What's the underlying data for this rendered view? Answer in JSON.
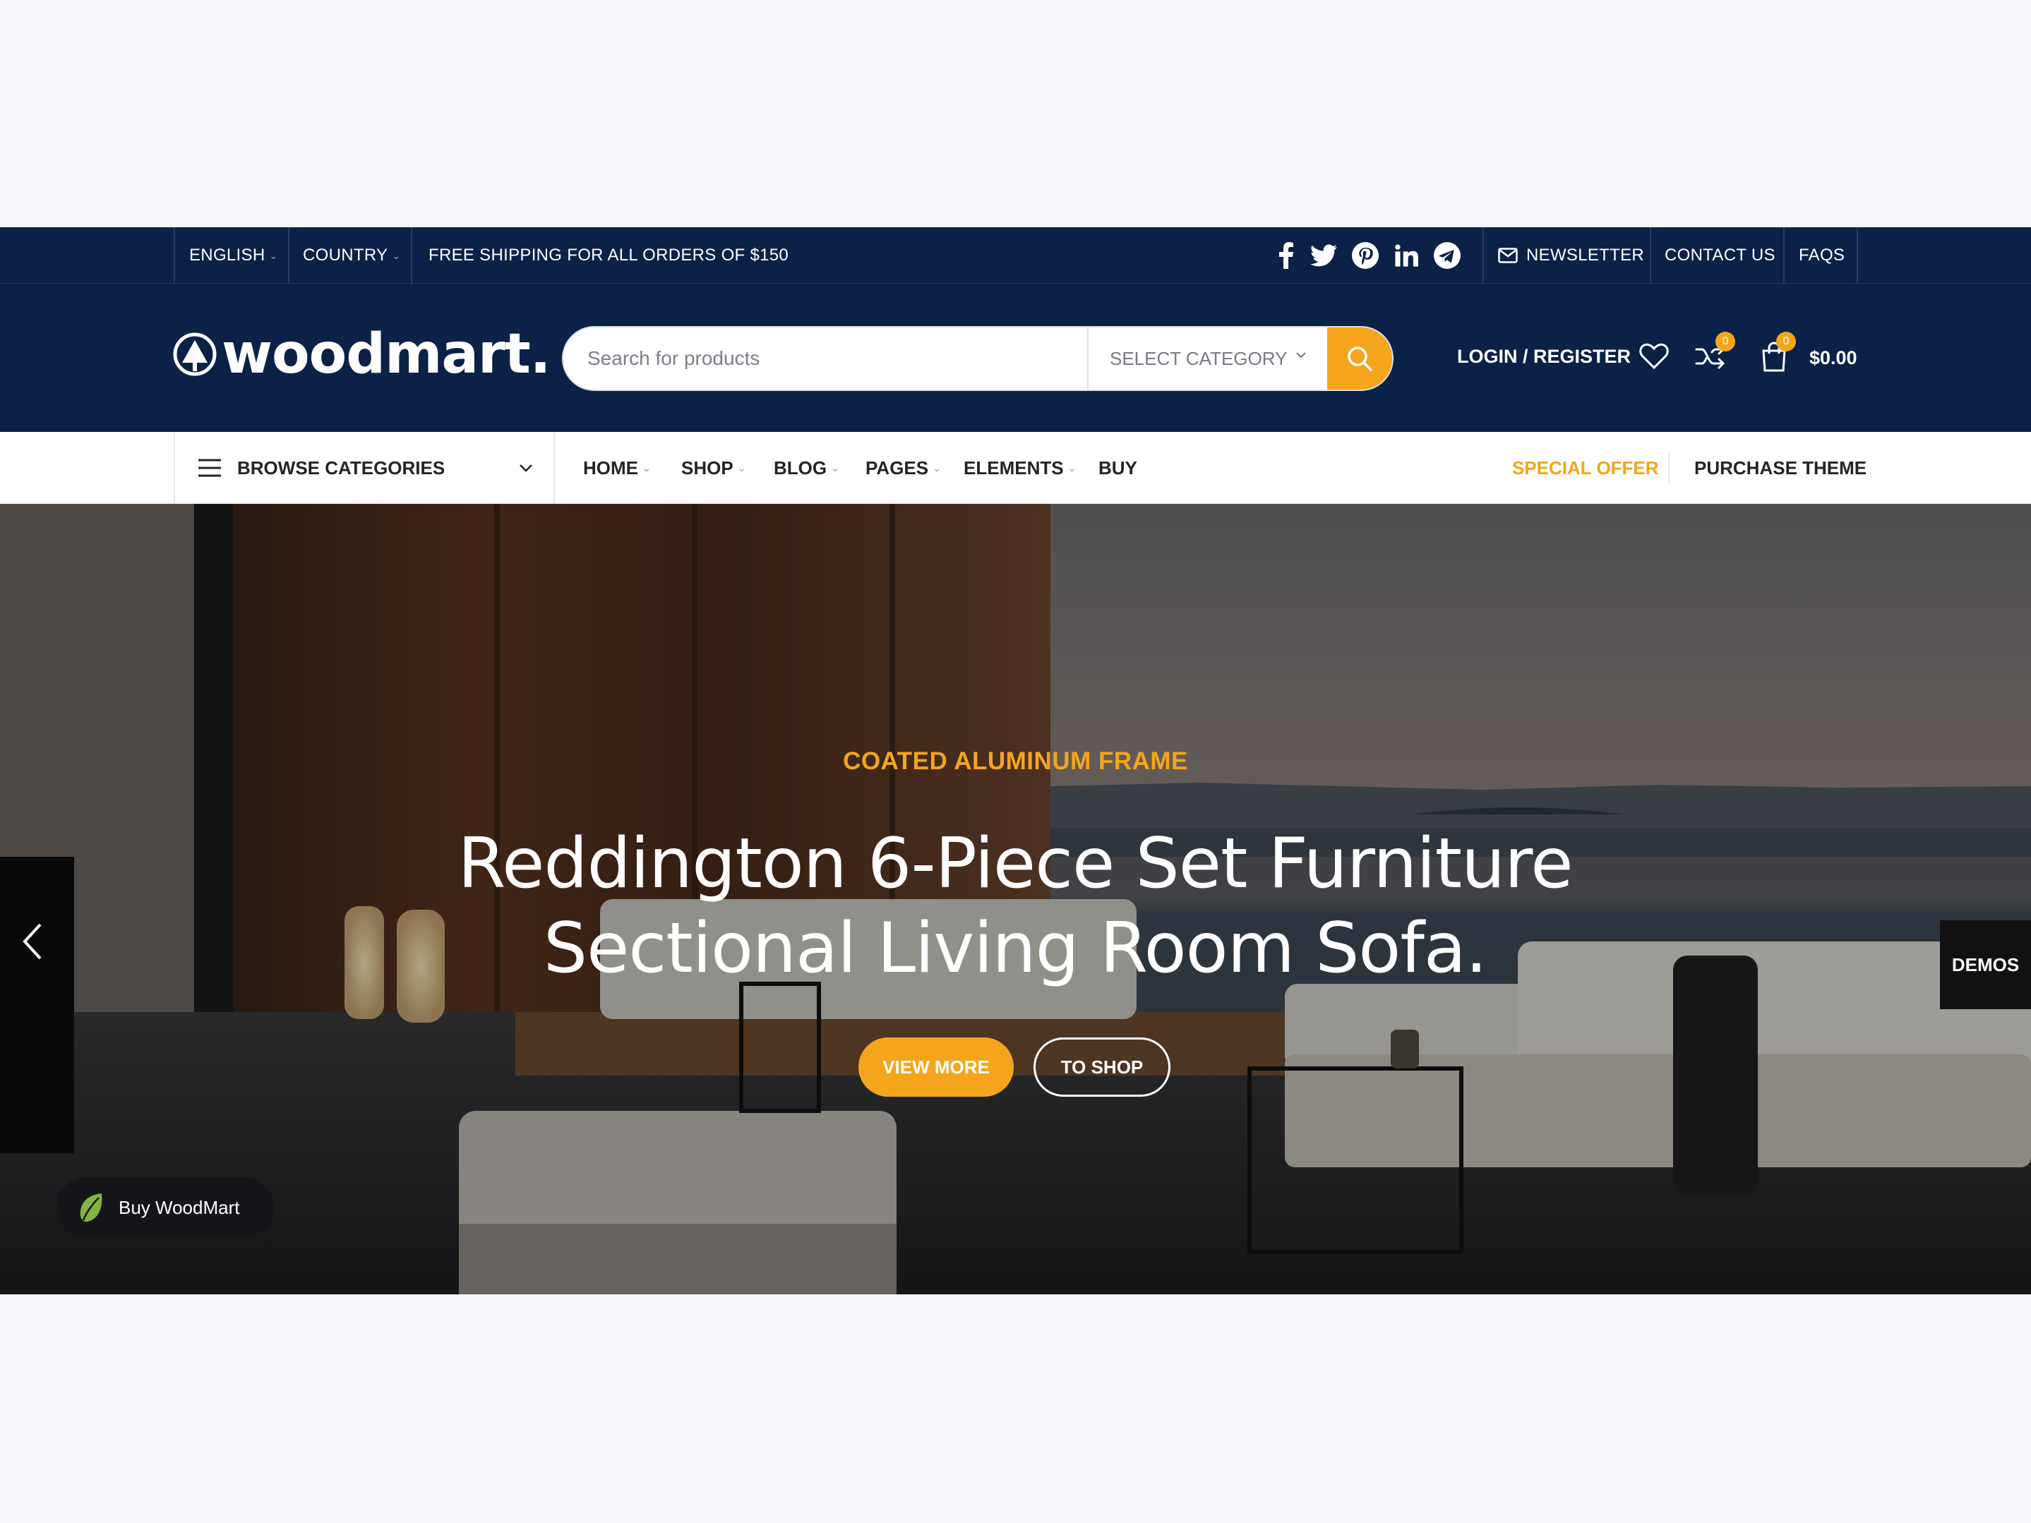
{
  "topbar": {
    "language": "ENGLISH",
    "country": "COUNTRY",
    "promo": "FREE SHIPPING FOR ALL ORDERS OF $150",
    "social": [
      "facebook-icon",
      "twitter-icon",
      "pinterest-icon",
      "linkedin-icon",
      "telegram-icon"
    ],
    "newsletter": "NEWSLETTER",
    "contact": "CONTACT US",
    "faqs": "FAQS"
  },
  "header": {
    "logo": "woodmart.",
    "search_placeholder": "Search for products",
    "category": "SELECT CATEGORY",
    "login": "LOGIN / REGISTER",
    "compare_count": "0",
    "cart_count": "0",
    "cart_total": "$0.00"
  },
  "nav": {
    "browse": "BROWSE CATEGORIES",
    "items": [
      {
        "label": "HOME"
      },
      {
        "label": "SHOP"
      },
      {
        "label": "BLOG"
      },
      {
        "label": "PAGES"
      },
      {
        "label": "ELEMENTS"
      },
      {
        "label": "BUY"
      }
    ],
    "special": "SPECIAL OFFER",
    "purchase": "PURCHASE THEME"
  },
  "hero": {
    "subtitle": "COATED ALUMINUM FRAME",
    "title_line1": "Reddington 6-Piece Set Furniture",
    "title_line2": "Sectional Living Room Sofa.",
    "view_more": "VIEW MORE",
    "to_shop": "TO SHOP"
  },
  "floating": {
    "demos": "DEMOS",
    "buy": "Buy WoodMart"
  },
  "colors": {
    "navy": "#0b2147",
    "accent": "#f4a51c"
  }
}
